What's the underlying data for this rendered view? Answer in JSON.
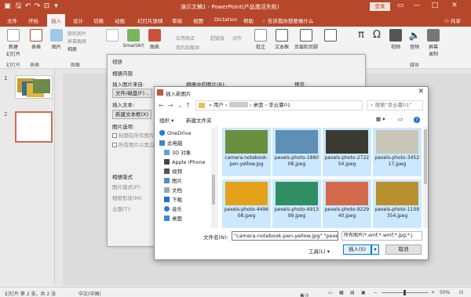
{
  "app": {
    "title": "演示文稿1 - PowerPoint(产品激活失败)",
    "login": "登录",
    "quick_access": [
      "save-icon",
      "undo-icon",
      "redo-icon",
      "start-from-beginning-icon"
    ],
    "window_controls": [
      "—",
      "□",
      "✕"
    ]
  },
  "menu": {
    "tabs": [
      "文件",
      "开始",
      "插入",
      "设计",
      "切换",
      "动画",
      "幻灯片放映",
      "审阅",
      "视图",
      "Dictation",
      "帮助"
    ],
    "active": "插入",
    "tell_me": "告诉我你想要做什么",
    "share": "共享"
  },
  "ribbon": {
    "buttons": [
      "新建\n幻灯片",
      "表格",
      "图片",
      "SmartArt",
      "图表",
      "批注",
      "文本框",
      "页眉和页脚",
      "视频",
      "音频",
      "屏幕\n录制"
    ],
    "small_items": [
      "联机图片",
      "屏幕截图",
      "相册",
      "应用商店",
      "我的加载项",
      "超链接",
      "动作"
    ],
    "groups": [
      "幻灯片",
      "表格",
      "图像",
      "媒体"
    ]
  },
  "slides": [
    {
      "num": "1"
    },
    {
      "num": "2"
    }
  ],
  "status": {
    "slide_info": "幻灯片 第 2 张，共 2 张",
    "lang": "中文(中国)",
    "notes": "备注",
    "zoom": "50%"
  },
  "album_dialog": {
    "title": "相册",
    "content_label": "相册内容",
    "insert_from": "插入图片来自:",
    "file_disk_btn": "文件/磁盘(F)...",
    "insert_text": "插入文本:",
    "new_textbox_btn": "新建文本框(X)",
    "picture_options": "图片选项:",
    "caption_under": "标题在所有图片下面(A)",
    "all_black_white": "所有图片以黑白方式显示(K)",
    "pictures_in_album": "相册中的图片(R):",
    "preview": "预览:",
    "album_layout": "相册版式",
    "picture_layout": "图片版式(P):",
    "frame_shape": "相框形状(M):",
    "theme": "主题(T):"
  },
  "file_dialog": {
    "title": "插入新图片",
    "path": [
      "此电脑",
      "用户",
      "",
      "桌面",
      "李云婁01"
    ],
    "search_placeholder": "搜索\"李云婁01\"",
    "organize": "组织 ▾",
    "new_folder": "新建文件夹",
    "nav_items": [
      "OneDrive",
      "此电脑",
      "3D 对象",
      "Apple iPhone",
      "视频",
      "图片",
      "文档",
      "下载",
      "音乐",
      "桌面"
    ],
    "files": [
      {
        "name": "camera-notebook-pen-yellow.jpg",
        "selected": true,
        "color": "#6b8f3e"
      },
      {
        "name": "pexels-photo-188008.jpeg",
        "selected": true,
        "color": "#5e8fb4"
      },
      {
        "name": "pexels-photo-272254.jpeg",
        "selected": true,
        "color": "#3a3a30"
      },
      {
        "name": "pexels-photo-345217.jpeg",
        "selected": true,
        "color": "#c9c5b8"
      },
      {
        "name": "pexels-photo-449608.jpeg",
        "selected": true,
        "color": "#e4a11a"
      },
      {
        "name": "pexels-photo-691399.jpeg",
        "selected": true,
        "color": "#2f8f62"
      },
      {
        "name": "pexels-photo-922940.jpeg",
        "selected": true,
        "color": "#d36a4c"
      },
      {
        "name": "pexels-photo-1109354.jpeg",
        "selected": true,
        "color": "#b8902f"
      }
    ],
    "filename_label": "文件名(N):",
    "filename_value": "\"camera-notebook-pen-yellow.jpg\" \"pexels-photo-188008.jpeg\"",
    "filetype_value": "所有图片(*.emf;*.wmf;*.jpg;*.j",
    "tools": "工具(L) ▾",
    "insert": "插入(S)",
    "cancel": "取消"
  }
}
